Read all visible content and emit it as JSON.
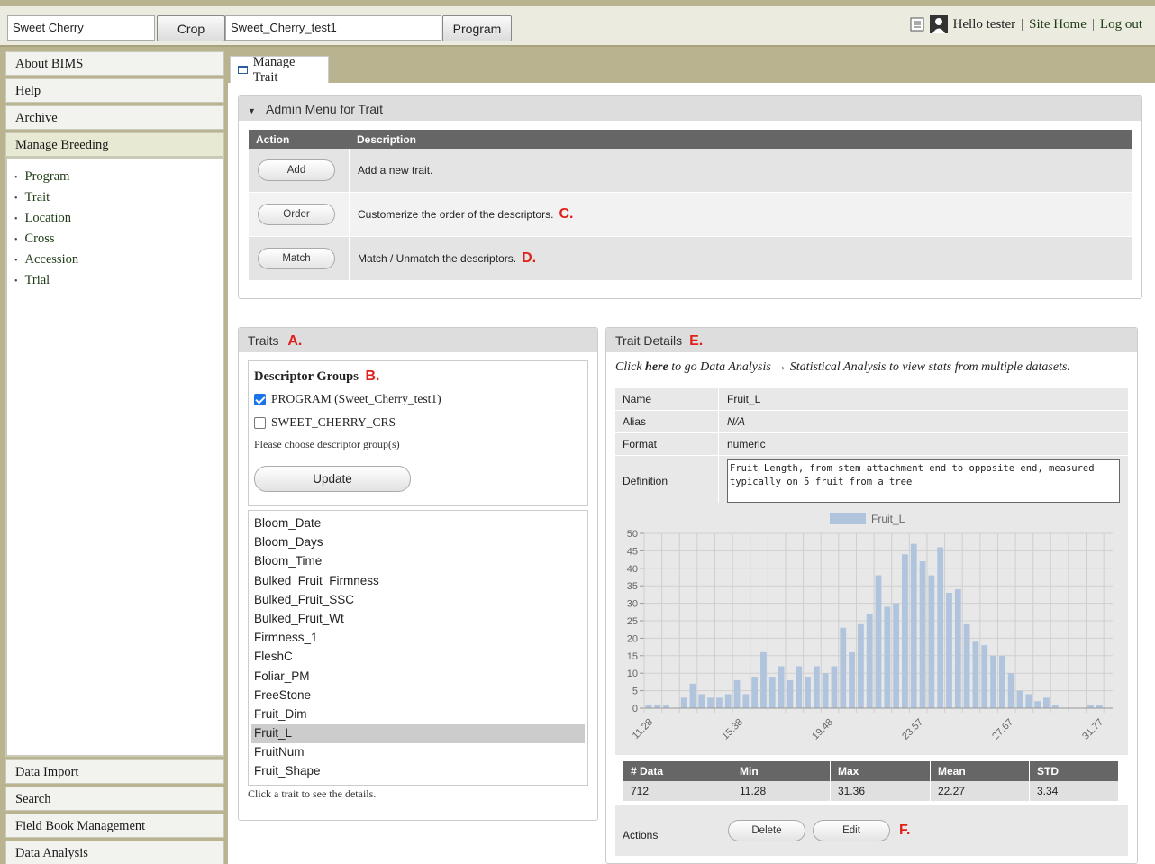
{
  "topbar": {
    "crop_value": "Sweet Cherry",
    "crop_button": "Crop",
    "program_value": "Sweet_Cherry_test1",
    "program_button": "Program",
    "greeting": "Hello tester",
    "separator": "|",
    "site_home": "Site Home",
    "logout": "Log out"
  },
  "sidebar": {
    "about": "About BIMS",
    "help": "Help",
    "archive": "Archive",
    "manage_breeding": "Manage Breeding",
    "sub_items": [
      "Program",
      "Trait",
      "Location",
      "Cross",
      "Accession",
      "Trial"
    ],
    "data_import": "Data Import",
    "search": "Search",
    "field_book": "Field Book Management",
    "data_analysis": "Data Analysis"
  },
  "tab": {
    "label": "Manage Trait"
  },
  "admin": {
    "title": "Admin Menu for Trait",
    "col_action": "Action",
    "col_description": "Description",
    "rows": [
      {
        "button": "Add",
        "desc": "Add a new trait.",
        "marker": ""
      },
      {
        "button": "Order",
        "desc": "Customerize the order of the descriptors.",
        "marker": "C."
      },
      {
        "button": "Match",
        "desc": "Match / Unmatch the descriptors.",
        "marker": "D."
      }
    ]
  },
  "traits": {
    "title": "Traits",
    "marker": "A.",
    "desc_groups_title": "Descriptor Groups",
    "desc_groups_marker": "B.",
    "group1": "PROGRAM (Sweet_Cherry_test1)",
    "group2": "SWEET_CHERRY_CRS",
    "hint": "Please choose descriptor group(s)",
    "update_button": "Update",
    "list": [
      "Bloom_Date",
      "Bloom_Days",
      "Bloom_Time",
      "Bulked_Fruit_Firmness",
      "Bulked_Fruit_SSC",
      "Bulked_Fruit_Wt",
      "Firmness_1",
      "FleshC",
      "Foliar_PM",
      "FreeStone",
      "Fruit_Dim",
      "Fruit_L",
      "FruitNum",
      "Fruit_Shape"
    ],
    "selected": "Fruit_L",
    "footer": "Click a trait to see the details."
  },
  "details": {
    "title": "Trait Details",
    "marker": "E.",
    "note_pre": "Click ",
    "note_link": "here",
    "note_post": " to go Data Analysis → Statistical Analysis to view stats from multiple datasets.",
    "name_label": "Name",
    "name_value": "Fruit_L",
    "alias_label": "Alias",
    "alias_value": "N/A",
    "format_label": "Format",
    "format_value": "numeric",
    "definition_label": "Definition",
    "definition_value": "Fruit Length, from stem attachment end to opposite end, measured typically on 5 fruit from a tree",
    "stats_headers": [
      "# Data",
      "Min",
      "Max",
      "Mean",
      "STD"
    ],
    "stats_values": [
      "712",
      "11.28",
      "31.36",
      "22.27",
      "3.34"
    ],
    "actions_label": "Actions",
    "delete_button": "Delete",
    "edit_button": "Edit",
    "actions_marker": "F."
  },
  "chart_data": {
    "type": "bar",
    "series": [
      {
        "name": "Fruit_L",
        "values": [
          1,
          1,
          1,
          0,
          3,
          7,
          4,
          3,
          3,
          4,
          8,
          4,
          9,
          16,
          9,
          12,
          8,
          12,
          9,
          12,
          10,
          12,
          23,
          16,
          24,
          27,
          38,
          29,
          30,
          44,
          47,
          42,
          38,
          46,
          33,
          34,
          24,
          19,
          18,
          15,
          15,
          10,
          5,
          4,
          2,
          3,
          1,
          0,
          0,
          0,
          1,
          1,
          0
        ]
      }
    ],
    "x_ticks": [
      "11.28",
      "15.38",
      "19.48",
      "23.57",
      "27.67",
      "31.77"
    ],
    "y_ticks": [
      "0",
      "5",
      "10",
      "15",
      "20",
      "25",
      "30",
      "35",
      "40",
      "45",
      "50"
    ],
    "ylim": [
      0,
      50
    ],
    "legend_position": "top",
    "color": "#b0c4de",
    "grid": true
  }
}
